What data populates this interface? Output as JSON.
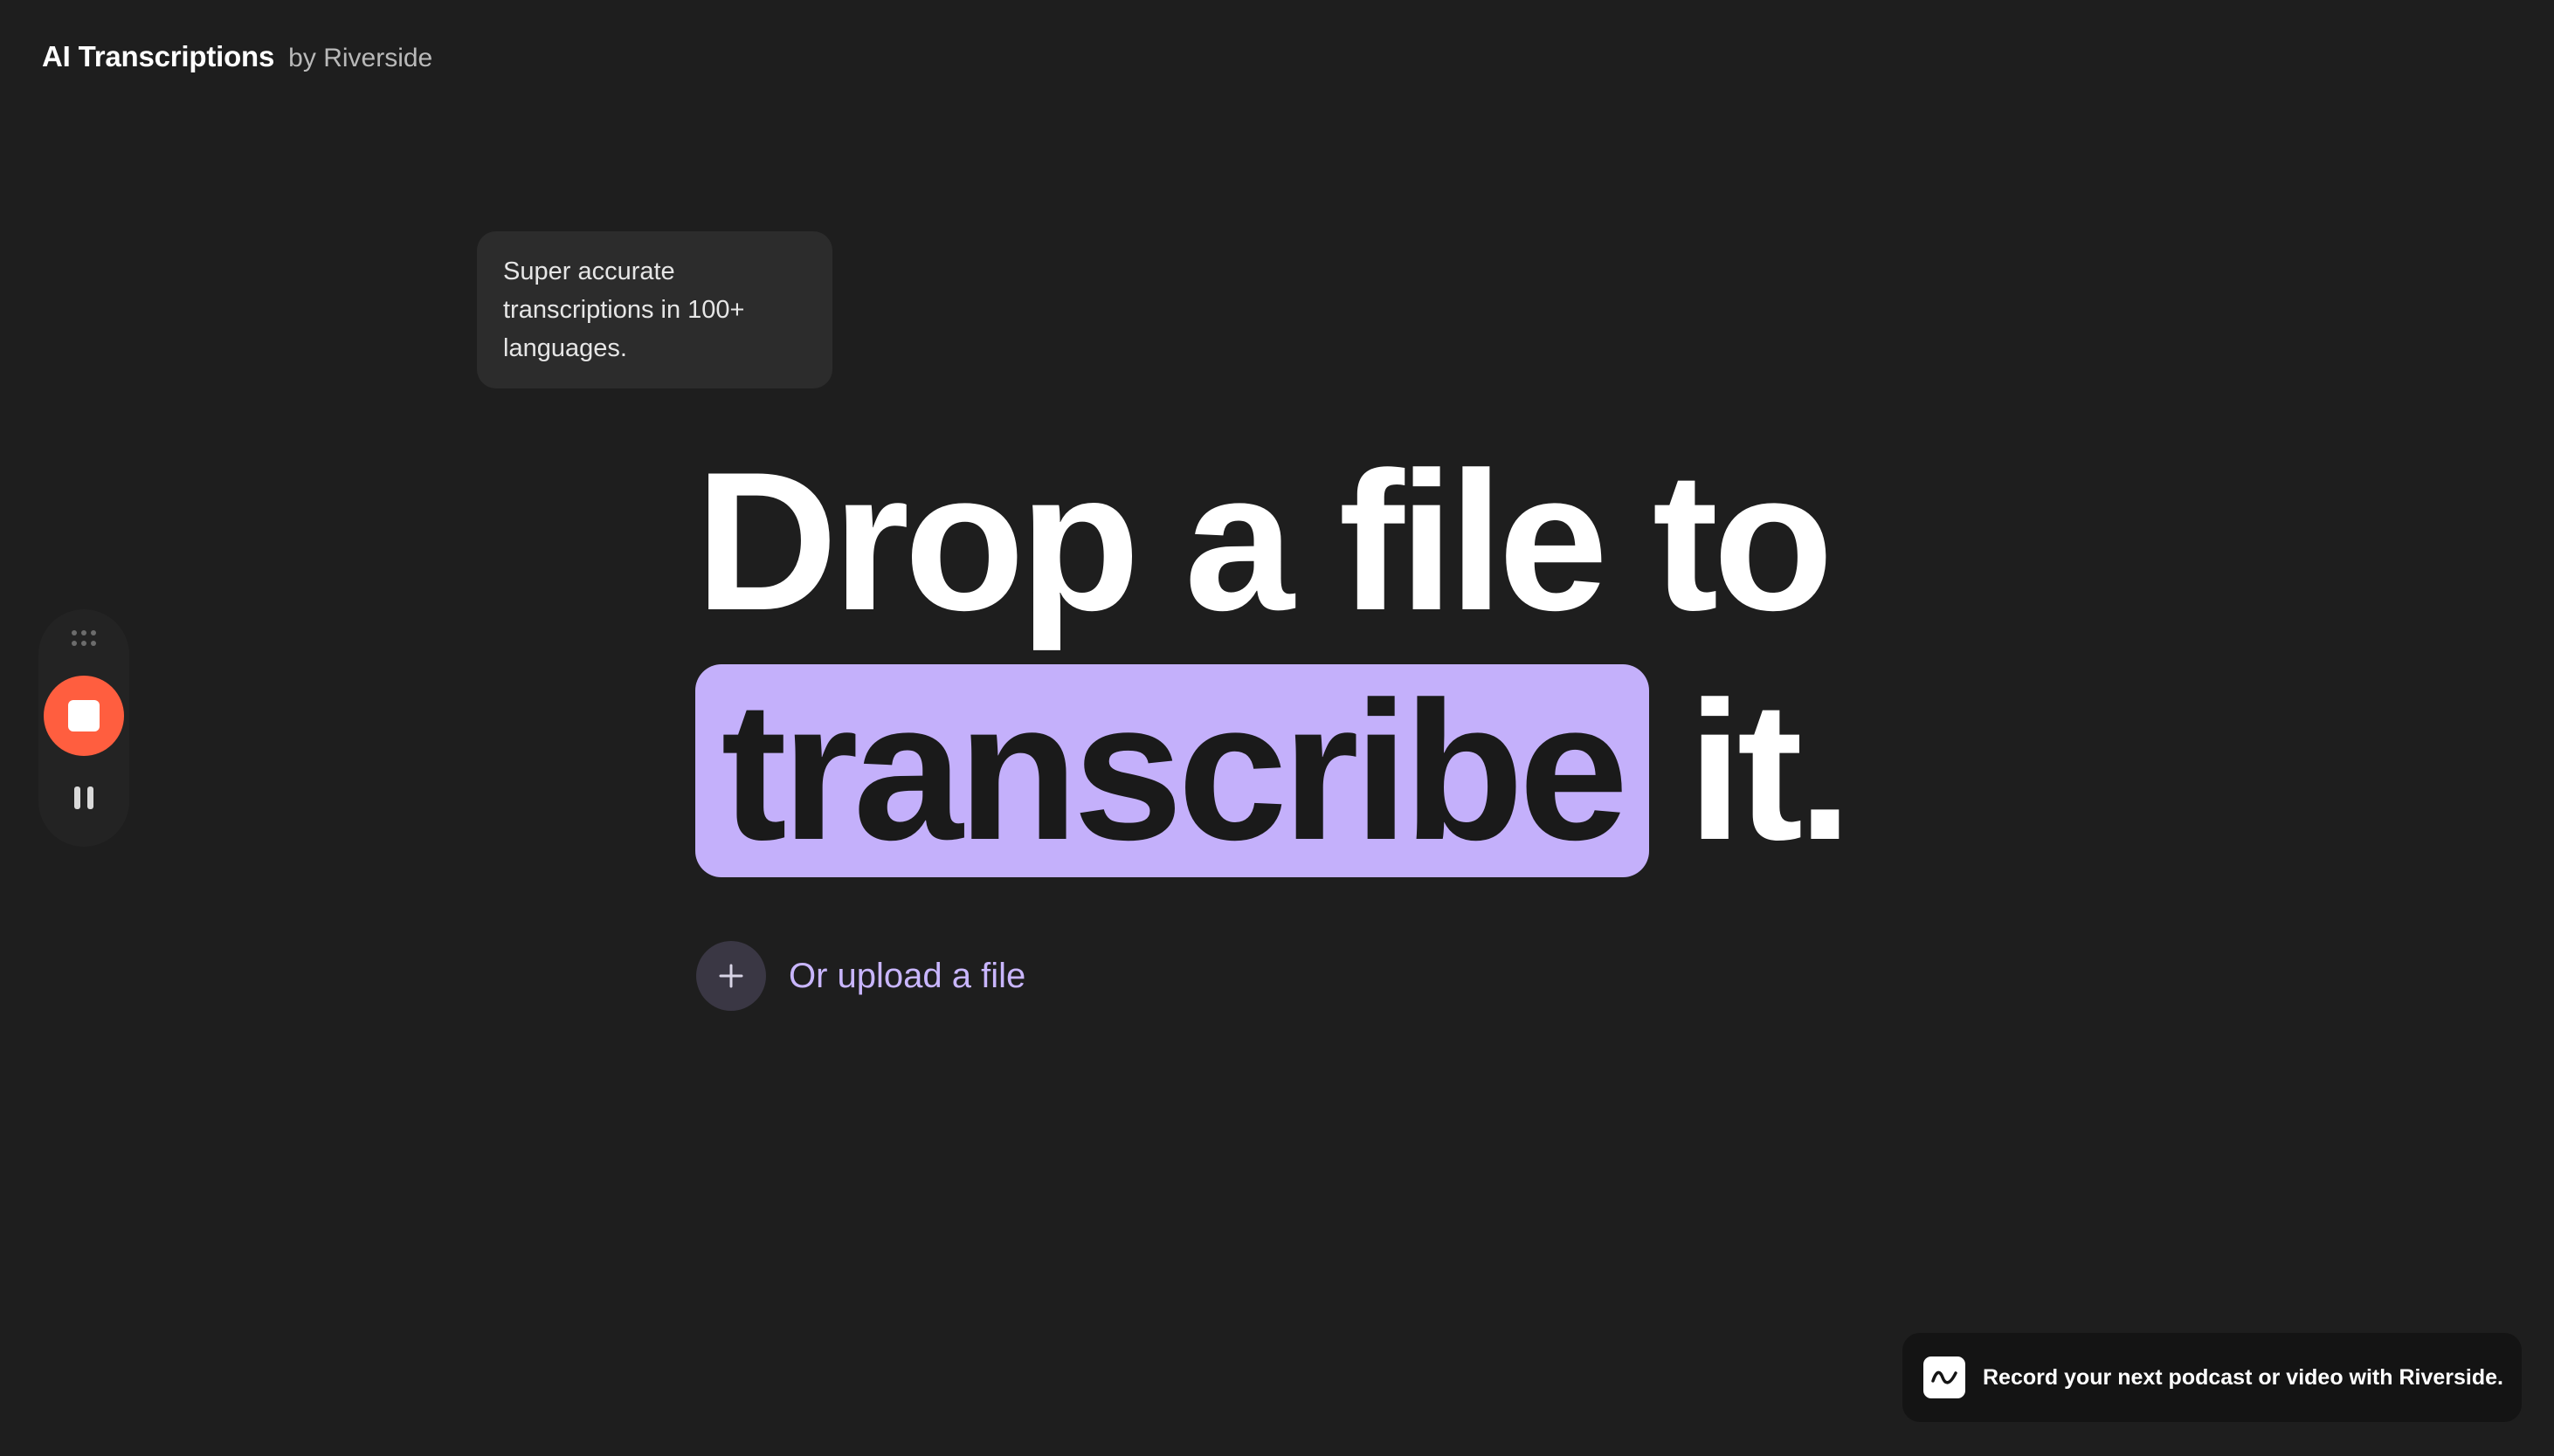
{
  "header": {
    "title": "AI Transcriptions",
    "subtitle": "by Riverside"
  },
  "tooltip": {
    "text": "Super accurate transcriptions in 100+ languages."
  },
  "hero": {
    "line1": "Drop a file to",
    "highlight": "transcribe",
    "line2_end": "it."
  },
  "upload": {
    "icon": "plus-icon",
    "label": "Or upload a file"
  },
  "recorder": {
    "handle_icon": "drag-handle-icon",
    "stop_icon": "stop-icon",
    "pause_icon": "pause-icon"
  },
  "promo": {
    "icon": "riverside-logo-icon",
    "text": "Record your next podcast or video with Riverside."
  },
  "colors": {
    "background": "#1e1e1e",
    "accent_highlight": "#c4b0fb",
    "accent_text": "#c9b6ff",
    "record_red": "#ff5e3f"
  }
}
